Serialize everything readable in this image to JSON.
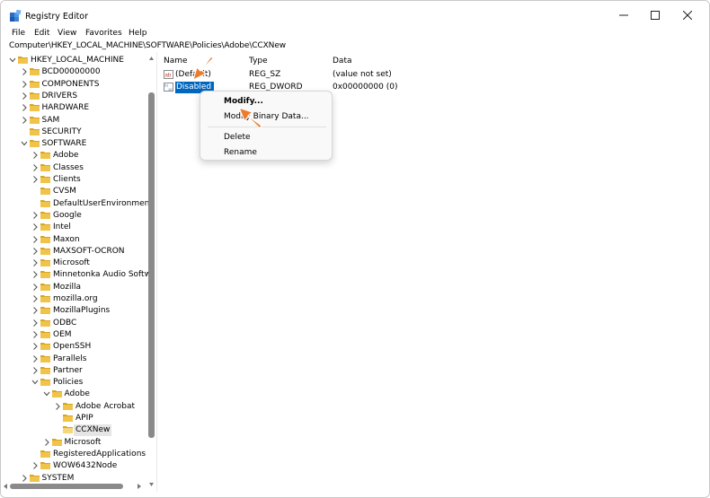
{
  "window": {
    "title": "Registry Editor",
    "controls": {
      "minimize": "—",
      "maximize": "☐",
      "close": "✕"
    }
  },
  "menu": [
    "File",
    "Edit",
    "View",
    "Favorites",
    "Help"
  ],
  "address": "Computer\\HKEY_LOCAL_MACHINE\\SOFTWARE\\Policies\\Adobe\\CCXNew",
  "tree": [
    {
      "label": "HKEY_LOCAL_MACHINE",
      "expander": "expanded",
      "depth": 0
    },
    {
      "label": "BCD00000000",
      "expander": "collapsed",
      "depth": 1
    },
    {
      "label": "COMPONENTS",
      "expander": "collapsed",
      "depth": 1
    },
    {
      "label": "DRIVERS",
      "expander": "collapsed",
      "depth": 1
    },
    {
      "label": "HARDWARE",
      "expander": "collapsed",
      "depth": 1
    },
    {
      "label": "SAM",
      "expander": "collapsed",
      "depth": 1
    },
    {
      "label": "SECURITY",
      "expander": "none",
      "depth": 1
    },
    {
      "label": "SOFTWARE",
      "expander": "expanded",
      "depth": 1
    },
    {
      "label": "Adobe",
      "expander": "collapsed",
      "depth": 2
    },
    {
      "label": "Classes",
      "expander": "collapsed",
      "depth": 2
    },
    {
      "label": "Clients",
      "expander": "collapsed",
      "depth": 2
    },
    {
      "label": "CVSM",
      "expander": "none",
      "depth": 2
    },
    {
      "label": "DefaultUserEnvironment",
      "expander": "none",
      "depth": 2
    },
    {
      "label": "Google",
      "expander": "collapsed",
      "depth": 2
    },
    {
      "label": "Intel",
      "expander": "collapsed",
      "depth": 2
    },
    {
      "label": "Maxon",
      "expander": "collapsed",
      "depth": 2
    },
    {
      "label": "MAXSOFT-OCRON",
      "expander": "collapsed",
      "depth": 2
    },
    {
      "label": "Microsoft",
      "expander": "collapsed",
      "depth": 2
    },
    {
      "label": "Minnetonka Audio Softw",
      "expander": "collapsed",
      "depth": 2
    },
    {
      "label": "Mozilla",
      "expander": "collapsed",
      "depth": 2
    },
    {
      "label": "mozilla.org",
      "expander": "collapsed",
      "depth": 2
    },
    {
      "label": "MozillaPlugins",
      "expander": "collapsed",
      "depth": 2
    },
    {
      "label": "ODBC",
      "expander": "collapsed",
      "depth": 2
    },
    {
      "label": "OEM",
      "expander": "collapsed",
      "depth": 2
    },
    {
      "label": "OpenSSH",
      "expander": "collapsed",
      "depth": 2
    },
    {
      "label": "Parallels",
      "expander": "collapsed",
      "depth": 2
    },
    {
      "label": "Partner",
      "expander": "collapsed",
      "depth": 2
    },
    {
      "label": "Policies",
      "expander": "expanded",
      "depth": 2
    },
    {
      "label": "Adobe",
      "expander": "expanded",
      "depth": 3
    },
    {
      "label": "Adobe Acrobat",
      "expander": "collapsed",
      "depth": 4
    },
    {
      "label": "APIP",
      "expander": "none",
      "depth": 4
    },
    {
      "label": "CCXNew",
      "expander": "none",
      "depth": 4,
      "selected": true
    },
    {
      "label": "Microsoft",
      "expander": "collapsed",
      "depth": 3
    },
    {
      "label": "RegisteredApplications",
      "expander": "none",
      "depth": 2
    },
    {
      "label": "WOW6432Node",
      "expander": "collapsed",
      "depth": 2
    },
    {
      "label": "SYSTEM",
      "expander": "collapsed",
      "depth": 1
    }
  ],
  "list": {
    "headers": {
      "name": "Name",
      "type": "Type",
      "data": "Data"
    },
    "rows": [
      {
        "name": "(Default)",
        "type": "REG_SZ",
        "data": "(value not set)",
        "icon": "string-value-icon"
      },
      {
        "name": "Disabled",
        "type": "REG_DWORD",
        "data": "0x00000000 (0)",
        "icon": "binary-value-icon",
        "selected": true
      }
    ]
  },
  "context_menu": {
    "modify": "Modify...",
    "modify_binary": "Modify Binary Data...",
    "delete": "Delete",
    "rename": "Rename"
  },
  "colors": {
    "selection": "#0067c0",
    "folder": "#e8b838",
    "arrow": "#ee7b2b",
    "watermark": "#f3dcd0"
  }
}
